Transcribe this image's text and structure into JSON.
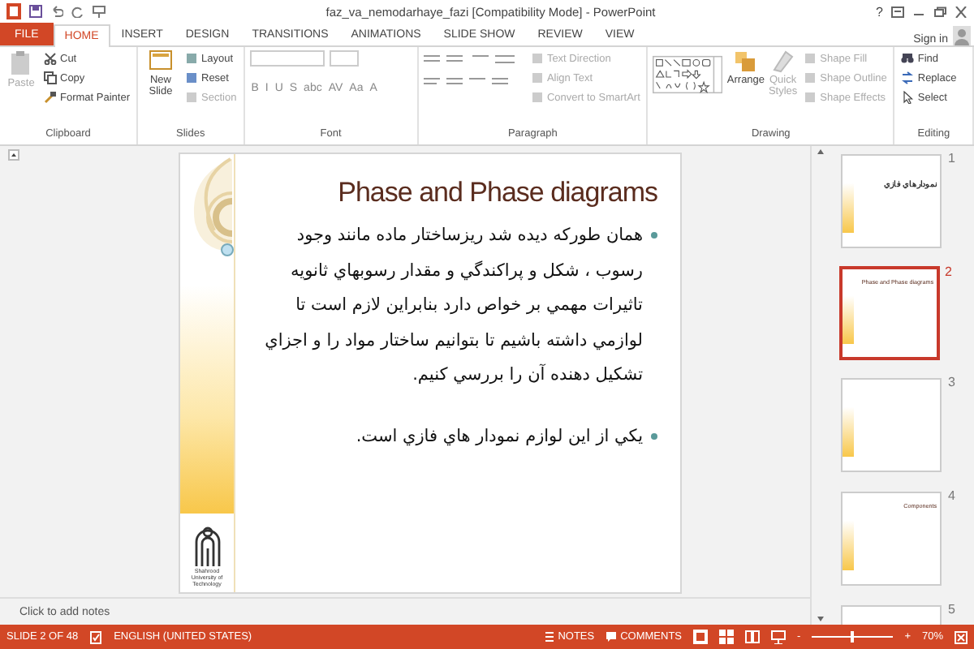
{
  "window": {
    "title": "faz_va_nemodarhaye_fazi [Compatibility Mode] - PowerPoint",
    "help": "?",
    "sign_in": "Sign in"
  },
  "tabs": [
    {
      "label": "FILE",
      "kind": "file",
      "selected": false
    },
    {
      "label": "HOME",
      "kind": "tab",
      "selected": true
    },
    {
      "label": "INSERT",
      "kind": "tab",
      "selected": false
    },
    {
      "label": "DESIGN",
      "kind": "tab",
      "selected": false
    },
    {
      "label": "TRANSITIONS",
      "kind": "tab",
      "selected": false
    },
    {
      "label": "ANIMATIONS",
      "kind": "tab",
      "selected": false
    },
    {
      "label": "SLIDE SHOW",
      "kind": "tab",
      "selected": false
    },
    {
      "label": "REVIEW",
      "kind": "tab",
      "selected": false
    },
    {
      "label": "VIEW",
      "kind": "tab",
      "selected": false
    }
  ],
  "ribbon": {
    "clipboard": {
      "label": "Clipboard",
      "paste": "Paste",
      "cut": "Cut",
      "copy": "Copy",
      "format_painter": "Format Painter"
    },
    "slides": {
      "label": "Slides",
      "new_slide": "New Slide",
      "layout": "Layout",
      "reset": "Reset",
      "section": "Section"
    },
    "font": {
      "label": "Font",
      "buttons": [
        "B",
        "I",
        "U",
        "S",
        "abc",
        "AV",
        "Aa",
        "A"
      ]
    },
    "paragraph": {
      "label": "Paragraph",
      "text_direction": "Text Direction",
      "align_text": "Align Text",
      "convert": "Convert to SmartArt"
    },
    "drawing": {
      "label": "Drawing",
      "arrange": "Arrange",
      "quick_styles": "Quick Styles",
      "shape_fill": "Shape Fill",
      "shape_outline": "Shape Outline",
      "shape_effects": "Shape Effects"
    },
    "editing": {
      "label": "Editing",
      "find": "Find",
      "replace": "Replace",
      "select": "Select"
    }
  },
  "slide": {
    "title": "Phase and Phase diagrams",
    "bullets": [
      "همان طوركه ديده شد ريزساختار ماده مانند وجود رسوب ، شكل و پراكندگي و مقدار رسوبهاي ثانويه تاثيرات مهمي بر خواص دارد بنابراين لازم است تا لوازمي داشته باشيم تا بتوانيم ساختار مواد را و اجزاي تشكيل دهنده آن را بررسي كنيم.",
      "يكي از اين لوازم نمودار هاي فازي است."
    ],
    "logo_text": "Shahrood University of Technology"
  },
  "thumbnails": [
    {
      "number": "1",
      "title": "نمودارهاي فازي",
      "selected": false
    },
    {
      "number": "2",
      "title": "Phase and Phase diagrams",
      "selected": true
    },
    {
      "number": "3",
      "selected": false
    },
    {
      "number": "4",
      "title": "Components",
      "selected": false
    },
    {
      "number": "5",
      "selected": false
    }
  ],
  "notes": {
    "placeholder": "Click to add notes"
  },
  "status_bar": {
    "slide_info": "SLIDE 2 OF 48",
    "language": "ENGLISH (UNITED STATES)",
    "notes": "NOTES",
    "comments": "COMMENTS",
    "zoom_out": "-",
    "zoom_in": "+",
    "zoom": "70%",
    "level": 0.5
  }
}
